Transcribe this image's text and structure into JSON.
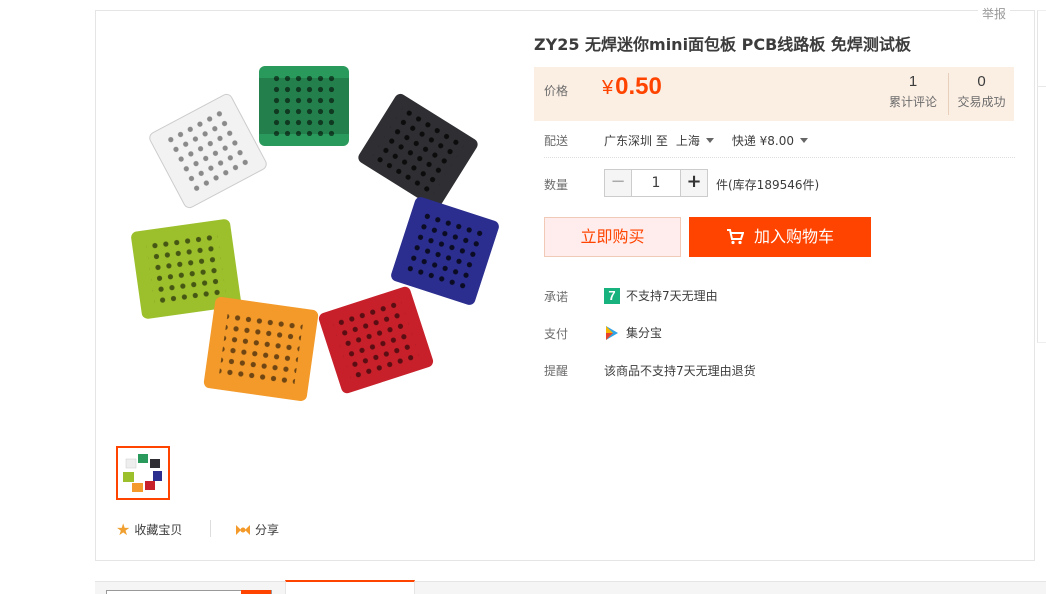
{
  "header": {
    "report_label": "举报"
  },
  "product": {
    "title": "ZY25 无焊迷你mini面包板 PCB线路板 免焊测试板",
    "price_label": "价格",
    "currency": "¥",
    "price": "0.50",
    "stats": [
      {
        "value": "1",
        "label": "累计评论"
      },
      {
        "value": "0",
        "label": "交易成功"
      }
    ]
  },
  "shipping": {
    "label": "配送",
    "origin": "广东深圳 至",
    "destination": "上海",
    "method": "快递 ¥8.00"
  },
  "quantity": {
    "label": "数量",
    "minus": "−",
    "value": "1",
    "plus": "+",
    "stock_text": "件(库存189546件)"
  },
  "actions": {
    "buy_now": "立即购买",
    "add_to_cart": "加入购物车"
  },
  "service": {
    "promise_label": "承诺",
    "promise_badge": "7",
    "promise_text": "不支持7天无理由",
    "pay_label": "支付",
    "pay_text": "集分宝",
    "remind_label": "提醒",
    "remind_text": "该商品不支持7天无理由退货"
  },
  "footer_actions": {
    "favorite": "收藏宝贝",
    "share": "分享"
  },
  "colors": {
    "accent": "#ff4400",
    "price_bg": "#fbeee3",
    "board_colors": [
      "#2a9a5c",
      "#2f2f33",
      "#2b2e8e",
      "#c8202a",
      "#f39a2a",
      "#9cc02c",
      "#f2f2f2"
    ]
  },
  "icons": [
    "star-icon",
    "share-icon",
    "cart-icon",
    "seven-day-badge-icon",
    "jifenbao-icon"
  ]
}
